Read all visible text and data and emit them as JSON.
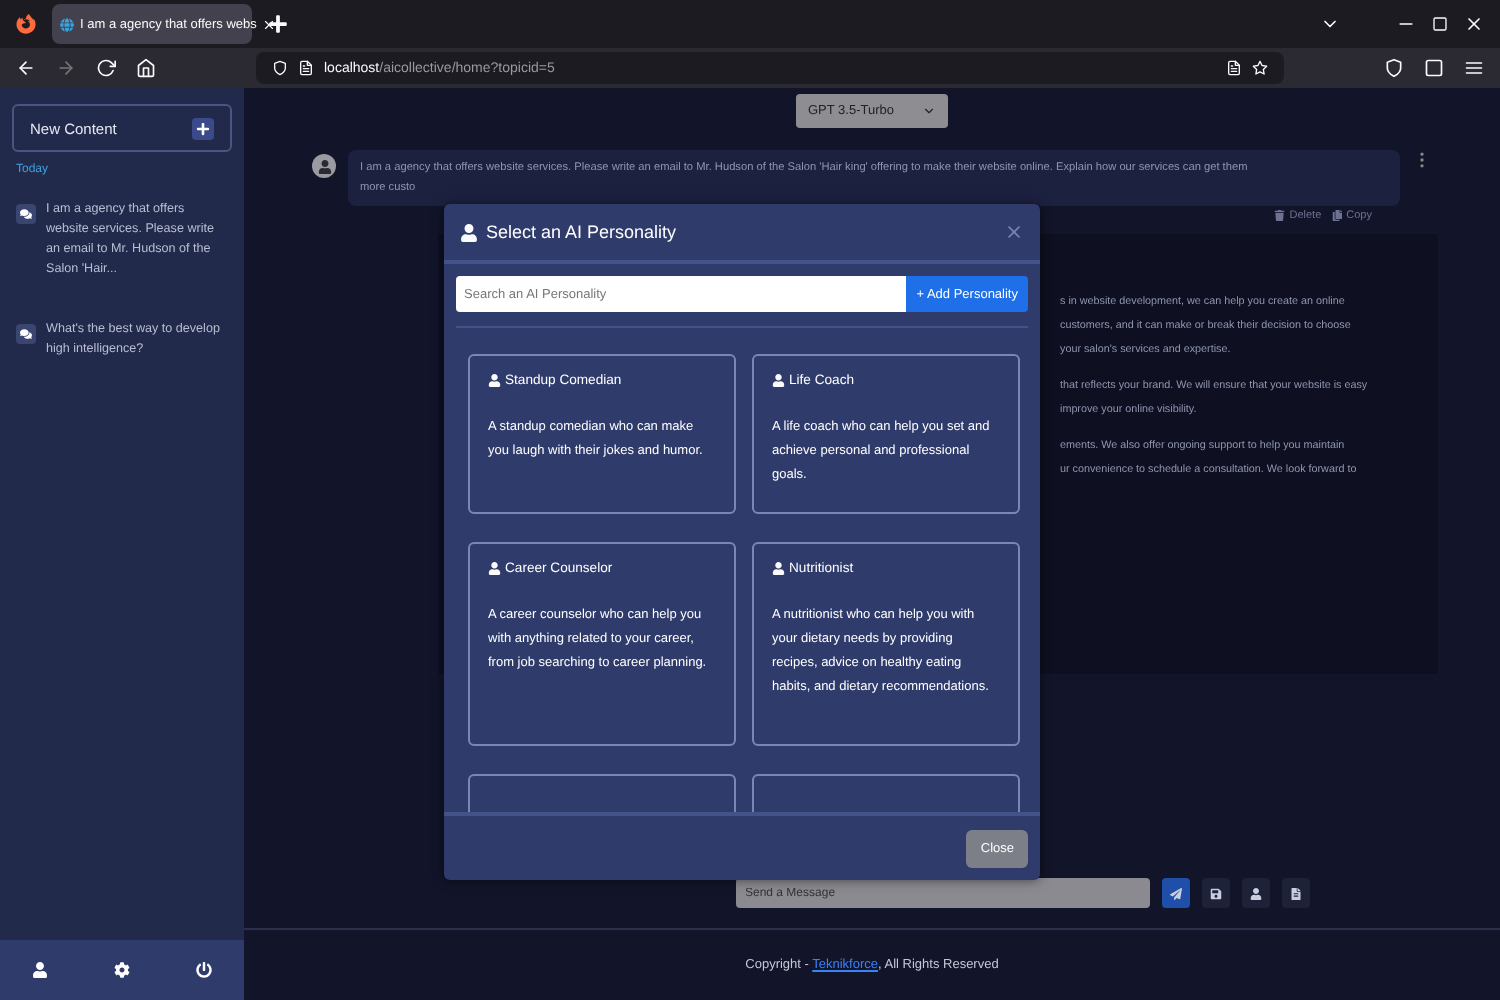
{
  "browser": {
    "tab_title": "I am a agency that offers webs",
    "url_host": "localhost",
    "url_path": "/aicollective/home?topicid=5"
  },
  "sidebar": {
    "new_content": "New Content",
    "section": "Today",
    "items": [
      {
        "text": "I am a agency that offers website services. Please write an email to Mr. Hudson of the Salon 'Hair..."
      },
      {
        "text": "What's the best way to develop high intelligence?"
      }
    ]
  },
  "main": {
    "model": "GPT 3.5-Turbo",
    "user_message": [
      "I am a agency that offers website services. Please write an email to Mr. Hudson of the Salon 'Hair king' offering to make their website online. Explain how our services can get them",
      "more custo"
    ],
    "actions": [
      "Delete",
      "Copy"
    ],
    "response_lines": [
      "s in website development, we can help you create an online",
      "customers, and it can make or break their decision to choose",
      "your salon's services and expertise.",
      "that reflects your brand. We will ensure that your website is easy",
      "improve your online visibility.",
      "ements. We also offer ongoing support to help you maintain",
      "ur convenience to schedule a consultation. We look forward to"
    ],
    "composer_placeholder": "Send a Message",
    "footer": {
      "prefix": "Copyright - ",
      "link": "Teknikforce",
      "suffix": ", All Rights Reserved"
    }
  },
  "modal": {
    "title": "Select an AI Personality",
    "search_placeholder": "Search an AI Personality",
    "add_button": "+ Add Personality",
    "personalities": [
      {
        "name": "Standup Comedian",
        "description": "A standup comedian who can make you laugh with their jokes and humor."
      },
      {
        "name": "Life Coach",
        "description": "A life coach who can help you set and achieve personal and professional goals."
      },
      {
        "name": "Career Counselor",
        "description": "A career counselor who can help you with anything related to your career, from job searching to career planning."
      },
      {
        "name": "Nutritionist",
        "description": "A nutritionist who can help you with your dietary needs by providing recipes, advice on healthy eating habits, and dietary recommendations."
      }
    ],
    "close_button": "Close"
  }
}
